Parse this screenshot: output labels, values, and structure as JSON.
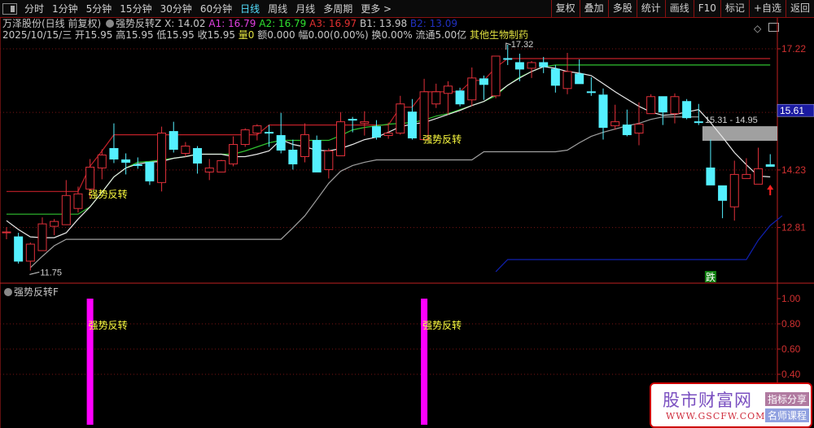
{
  "toolbar": {
    "periods": [
      "分时",
      "1分钟",
      "5分钟",
      "15分钟",
      "30分钟",
      "60分钟",
      "日线",
      "周线",
      "月线",
      "多周期",
      "更多 >"
    ],
    "active_period": "日线",
    "buttons": [
      "复权",
      "叠加",
      "多股",
      "统计",
      "画线",
      "F10",
      "标记",
      "+自选",
      "返回"
    ]
  },
  "info": {
    "stock": "万泽股份(日线 前复权)",
    "indicator": "强势反转Z",
    "x": "X: 14.02",
    "a1": "A1: 16.79",
    "a2": "A2: 16.79",
    "a3": "A3: 16.97",
    "b1": "B1: 13.98",
    "b2": "B2: 13.09",
    "date": "2025/10/15/三",
    "open": "开15.95",
    "high": "高15.95",
    "low": "低15.95",
    "close": "收15.95",
    "volume": "量0",
    "amount": "额0.000",
    "change": "幅0.00(0.00%)",
    "turnover": "换0.00%",
    "float": "流通5.00亿",
    "sector": "其他生物制药"
  },
  "colors": {
    "up": "#e0303a",
    "down": "#54f0ff",
    "green": "#30c030",
    "blue": "#1020b0",
    "magenta": "#ff00ff",
    "yellow": "#ffff40",
    "axis": "#c02020"
  },
  "chart_data": [
    {
      "type": "candlestick",
      "title": "万泽股份 日线",
      "ylim": [
        11.5,
        17.5
      ],
      "yticks": [
        17.22,
        15.65,
        14.23,
        12.81
      ],
      "current_price_label": "15.61",
      "ohlc": [
        [
          12.68,
          12.82,
          12.52,
          12.7
        ],
        [
          12.58,
          12.68,
          11.92,
          11.98
        ],
        [
          11.98,
          12.44,
          11.75,
          12.4
        ],
        [
          12.24,
          13.06,
          12.24,
          12.9
        ],
        [
          12.84,
          13.02,
          12.62,
          12.96
        ],
        [
          12.88,
          13.98,
          12.88,
          13.6
        ],
        [
          13.28,
          13.82,
          13.18,
          13.64
        ],
        [
          13.76,
          14.5,
          13.52,
          14.3
        ],
        [
          14.28,
          14.74,
          14.0,
          14.6
        ],
        [
          14.76,
          15.38,
          14.4,
          14.5
        ],
        [
          14.48,
          14.64,
          14.12,
          14.42
        ],
        [
          14.36,
          14.54,
          14.26,
          14.34
        ],
        [
          14.42,
          14.42,
          13.86,
          13.96
        ],
        [
          13.92,
          15.3,
          13.7,
          15.14
        ],
        [
          15.18,
          15.42,
          14.66,
          14.74
        ],
        [
          14.64,
          14.92,
          14.56,
          14.82
        ],
        [
          14.76,
          14.82,
          14.14,
          14.4
        ],
        [
          14.18,
          14.5,
          13.98,
          14.28
        ],
        [
          14.18,
          14.48,
          14.18,
          14.46
        ],
        [
          14.38,
          15.06,
          14.32,
          14.86
        ],
        [
          14.86,
          15.26,
          14.8,
          15.22
        ],
        [
          15.14,
          15.36,
          14.96,
          15.32
        ],
        [
          15.16,
          15.34,
          14.8,
          15.14
        ],
        [
          15.08,
          15.64,
          14.64,
          14.72
        ],
        [
          14.72,
          14.98,
          14.24,
          14.38
        ],
        [
          14.56,
          15.38,
          14.42,
          15.1
        ],
        [
          14.96,
          15.08,
          14.18,
          14.18
        ],
        [
          14.24,
          14.76,
          14.02,
          14.7
        ],
        [
          14.58,
          15.66,
          14.58,
          15.42
        ],
        [
          15.48,
          15.54,
          15.16,
          15.46
        ],
        [
          15.38,
          15.68,
          15.08,
          15.42
        ],
        [
          15.3,
          15.46,
          14.98,
          15.04
        ],
        [
          15.08,
          15.4,
          15.0,
          15.14
        ],
        [
          15.14,
          16.06,
          15.1,
          15.86
        ],
        [
          15.66,
          15.98,
          14.98,
          15.02
        ],
        [
          14.98,
          16.48,
          14.98,
          16.16
        ],
        [
          15.86,
          16.36,
          15.76,
          16.16
        ],
        [
          16.12,
          16.42,
          15.6,
          16.3
        ],
        [
          16.18,
          16.26,
          15.8,
          15.86
        ],
        [
          15.96,
          16.76,
          15.8,
          16.5
        ],
        [
          16.48,
          16.56,
          15.96,
          16.34
        ],
        [
          16.06,
          17.04,
          16.0,
          17.04
        ],
        [
          16.98,
          17.32,
          16.82,
          16.96
        ],
        [
          16.88,
          17.1,
          16.42,
          16.72
        ],
        [
          16.74,
          16.92,
          16.5,
          16.88
        ],
        [
          16.88,
          17.02,
          16.62,
          16.78
        ],
        [
          16.72,
          16.82,
          16.14,
          16.32
        ],
        [
          16.24,
          17.12,
          16.1,
          16.66
        ],
        [
          16.6,
          16.96,
          16.36,
          16.36
        ],
        [
          16.16,
          16.52,
          16.06,
          16.14
        ],
        [
          16.08,
          16.24,
          14.98,
          15.28
        ],
        [
          15.32,
          15.84,
          15.22,
          15.42
        ],
        [
          15.34,
          15.72,
          15.06,
          15.1
        ],
        [
          15.14,
          15.9,
          14.84,
          15.36
        ],
        [
          15.62,
          16.1,
          15.62,
          16.04
        ],
        [
          16.04,
          16.04,
          15.34,
          15.66
        ],
        [
          15.62,
          16.12,
          15.38,
          16.04
        ],
        [
          15.92,
          15.98,
          15.48,
          15.52
        ],
        [
          15.42,
          15.86,
          15.34,
          15.4
        ],
        [
          14.28,
          14.98,
          13.86,
          13.86
        ],
        [
          13.84,
          13.84,
          13.04,
          13.48
        ],
        [
          13.32,
          14.46,
          12.98,
          14.12
        ],
        [
          14.02,
          14.52,
          14.02,
          14.12
        ],
        [
          13.88,
          14.78,
          13.88,
          14.26
        ],
        [
          14.36,
          14.62,
          14.32,
          14.32
        ]
      ],
      "series": [
        {
          "name": "red-step",
          "color": "#c02028",
          "values": [
            13.7,
            13.7,
            13.7,
            13.7,
            13.7,
            13.7,
            13.7,
            14.32,
            14.7,
            15.1,
            15.1,
            15.1,
            15.1,
            15.1,
            15.1,
            15.1,
            15.1,
            15.1,
            15.1,
            15.1,
            15.1,
            15.1,
            15.34,
            15.34,
            15.34,
            15.34,
            15.34,
            15.34,
            15.34,
            15.34,
            15.34,
            15.34,
            15.34,
            15.78,
            15.78,
            16.16,
            16.16,
            16.16,
            16.16,
            16.44,
            16.44,
            16.76,
            16.98,
            16.98,
            16.98,
            16.98,
            16.98,
            16.98,
            16.98,
            16.98,
            16.98,
            16.98,
            16.98,
            16.98,
            16.98,
            16.98,
            16.98,
            16.98,
            16.98,
            16.98,
            16.98,
            16.98,
            16.98,
            16.98,
            16.98
          ]
        },
        {
          "name": "green",
          "color": "#30c030",
          "values": [
            13.14,
            13.14,
            13.14,
            13.14,
            13.14,
            13.14,
            13.14,
            13.32,
            13.68,
            14.06,
            14.28,
            14.42,
            14.44,
            14.48,
            14.52,
            14.56,
            14.62,
            14.62,
            14.62,
            14.62,
            14.7,
            14.8,
            14.9,
            14.96,
            14.96,
            14.96,
            14.96,
            14.96,
            15.08,
            15.22,
            15.28,
            15.32,
            15.36,
            15.38,
            15.4,
            15.46,
            15.56,
            15.62,
            15.72,
            15.82,
            15.92,
            16.06,
            16.32,
            16.52,
            16.66,
            16.78,
            16.82,
            16.82,
            16.82,
            16.82,
            16.82,
            16.82,
            16.82,
            16.82,
            16.82,
            16.82,
            16.82,
            16.82,
            16.82,
            16.82,
            16.82,
            16.82,
            16.82,
            16.82,
            16.82
          ]
        },
        {
          "name": "white",
          "color": "#e8e8e8",
          "values": [
            12.98,
            12.76,
            12.58,
            12.56,
            12.56,
            12.68,
            13.02,
            13.32,
            13.68,
            14.06,
            14.28,
            14.38,
            14.42,
            14.44,
            14.52,
            14.56,
            14.62,
            14.62,
            14.62,
            14.56,
            14.56,
            14.62,
            14.7,
            14.98,
            14.86,
            14.8,
            14.72,
            14.7,
            14.76,
            14.86,
            14.98,
            15.04,
            15.16,
            15.3,
            15.36,
            15.4,
            15.5,
            15.6,
            15.7,
            15.82,
            15.92,
            16.1,
            16.32,
            16.5,
            16.66,
            16.78,
            16.74,
            16.66,
            16.62,
            16.56,
            16.36,
            16.16,
            15.98,
            15.8,
            15.66,
            15.58,
            15.6,
            15.66,
            15.72,
            15.4,
            15.04,
            14.66,
            14.36,
            14.08,
            14.06
          ]
        },
        {
          "name": "gray",
          "color": "#a0a0a0",
          "values": [
            null,
            null,
            11.82,
            12.1,
            12.36,
            12.52,
            12.52,
            12.52,
            12.52,
            12.52,
            12.52,
            12.52,
            12.52,
            12.52,
            12.52,
            12.52,
            12.52,
            12.52,
            12.52,
            12.52,
            12.52,
            12.52,
            12.52,
            12.52,
            12.8,
            13.1,
            13.5,
            13.9,
            14.2,
            14.34,
            14.42,
            14.48,
            14.48,
            14.48,
            14.48,
            14.48,
            14.48,
            14.48,
            14.48,
            14.48,
            14.68,
            14.68,
            14.68,
            14.68,
            14.68,
            14.68,
            14.68,
            14.72,
            14.9,
            15.06,
            15.16,
            15.24,
            15.32,
            15.38,
            15.48,
            15.54,
            15.54,
            15.54,
            15.54,
            null,
            null,
            null,
            null,
            null,
            null
          ]
        },
        {
          "name": "blue",
          "color": "#1020b0",
          "values": [
            null,
            null,
            null,
            null,
            null,
            null,
            null,
            null,
            null,
            null,
            null,
            null,
            null,
            null,
            null,
            null,
            null,
            null,
            null,
            null,
            null,
            null,
            null,
            null,
            null,
            null,
            null,
            null,
            null,
            null,
            null,
            null,
            null,
            null,
            null,
            null,
            null,
            null,
            null,
            null,
            null,
            11.72,
            12.02,
            12.02,
            12.02,
            12.02,
            12.02,
            12.02,
            12.02,
            12.02,
            12.02,
            12.02,
            12.02,
            12.02,
            12.02,
            12.02,
            12.02,
            12.02,
            12.02,
            12.02,
            12.02,
            12.02,
            12.02,
            12.5,
            12.86,
            13.1
          ]
        }
      ],
      "zone": {
        "from_index": 59,
        "high": 15.31,
        "low": 14.95,
        "label": "15.31 - 14.95"
      },
      "annotations": [
        {
          "index": 7,
          "price": 13.55,
          "text": "强势反转"
        },
        {
          "index": 35,
          "price": 14.9,
          "text": "强势反转"
        }
      ],
      "high_label": {
        "index": 42,
        "price": 17.32,
        "text": "17.32"
      },
      "low_label": {
        "index": 2,
        "price": 11.75,
        "text": "11.75"
      },
      "fall_marker": {
        "index": 59,
        "text": "跌"
      },
      "up_arrow_index": 64
    },
    {
      "type": "bar",
      "title": "强势反转F",
      "ylim": [
        0,
        1.0
      ],
      "yticks": [
        "1.00",
        "0.80",
        "0.60",
        "0.40"
      ],
      "bars": [
        {
          "index": 7,
          "value": 1
        },
        {
          "index": 35,
          "value": 1
        }
      ],
      "labels": [
        {
          "index": 7,
          "value": 0.8,
          "text": "强势反转"
        },
        {
          "index": 35,
          "value": 0.8,
          "text": "强势反转"
        }
      ]
    }
  ],
  "watermark": {
    "logo": "股市财富网",
    "url": "WWW.GSCFW.COM",
    "tag1": "指标分享",
    "tag2": "名师课程"
  }
}
